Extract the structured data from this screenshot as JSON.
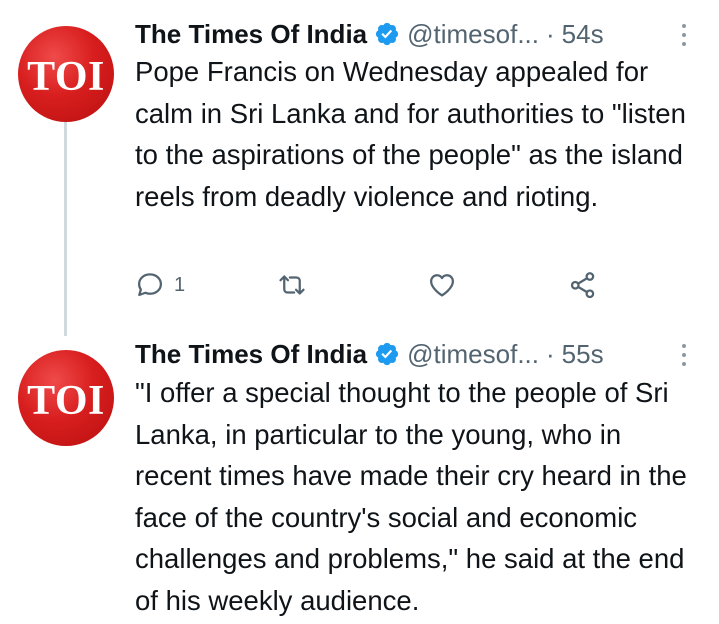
{
  "colors": {
    "brand_red": "#d81e1e",
    "verified_blue": "#1d9bf0",
    "text_primary": "#0f1419",
    "text_secondary": "#536471",
    "thread_line": "#cfd9de"
  },
  "tweets": [
    {
      "avatar_text": "TOI",
      "display_name": "The Times Of India",
      "verified_icon": "verified-badge-icon",
      "handle": "@timesof...",
      "separator": "·",
      "time": "54s",
      "text": "Pope Francis on Wednesday appealed for calm in Sri Lanka and for authorities to \"listen to the aspirations of the people\" as the island reels from deadly violence and rioting.",
      "actions": {
        "reply_icon": "reply-icon",
        "reply_count": "1",
        "retweet_icon": "retweet-icon",
        "like_icon": "heart-icon",
        "share_icon": "share-icon"
      }
    },
    {
      "avatar_text": "TOI",
      "display_name": "The Times Of India",
      "verified_icon": "verified-badge-icon",
      "handle": "@timesof...",
      "separator": "·",
      "time": "55s",
      "text": "\"I offer a special thought to the people of Sri Lanka, in particular to the young, who in recent times have made their cry heard in the face of the country's social and economic challenges and problems,\" he said at the end of his weekly audience."
    }
  ]
}
